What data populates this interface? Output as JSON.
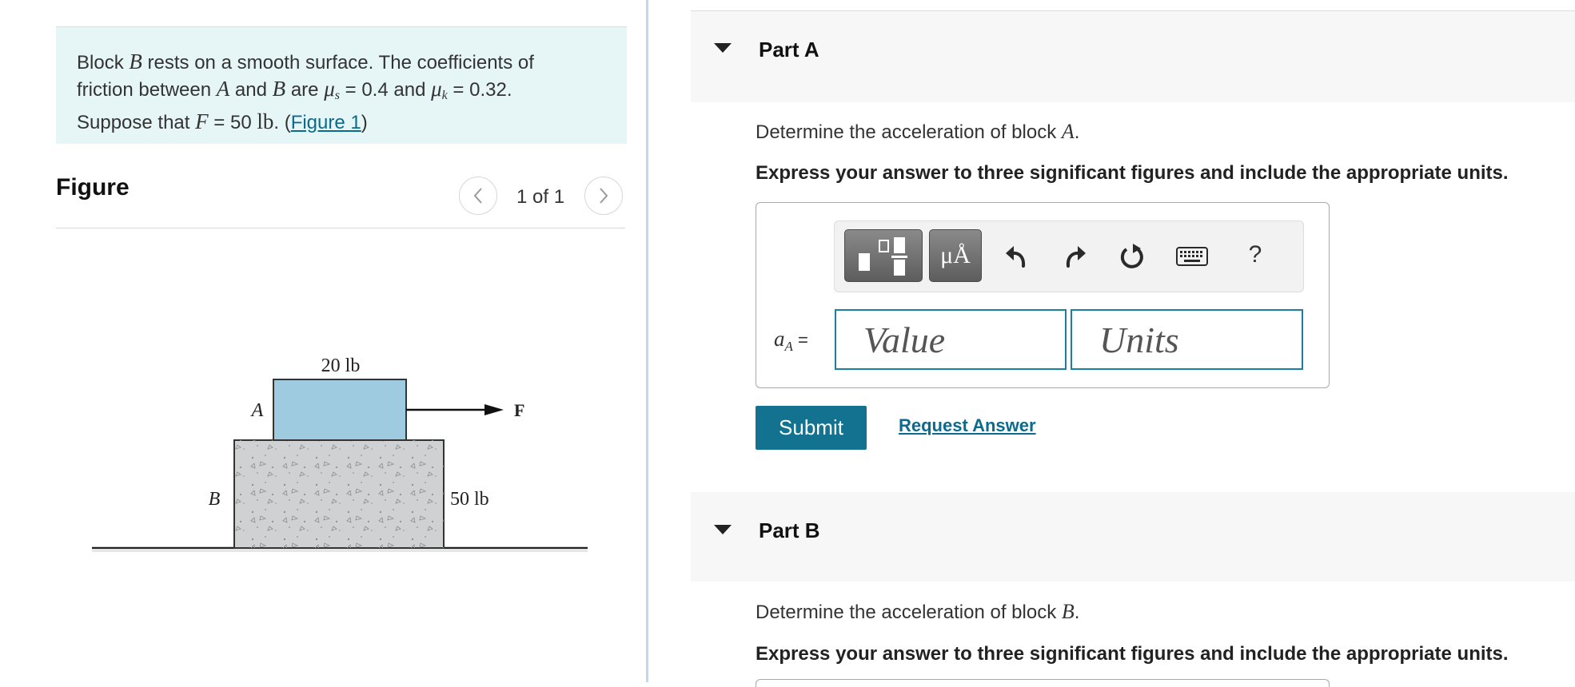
{
  "problem": {
    "line1_pre": "Block ",
    "var_B": "B",
    "line1_post": " rests on a smooth surface. The coefficients of",
    "line2_pre": "friction between ",
    "var_A": "A",
    "line2_and": " and ",
    "line2_are": " are ",
    "mu": "μ",
    "sub_s": "s",
    "mu_s_value": " = 0.4 and ",
    "sub_k": "k",
    "mu_k_value": " = 0.32.",
    "line3_pre": "Suppose that ",
    "var_F": "F",
    "line3_eq": " = 50 ",
    "unit_lb": "lb",
    "line3_paren_open": ". (",
    "figure_link": "Figure 1",
    "line3_paren_close": ")"
  },
  "figure": {
    "header": "Figure",
    "count": "1 of 1",
    "prev_icon": "chevron-left-icon",
    "next_icon": "chevron-right-icon",
    "labels": {
      "weight_a": "20 lb",
      "weight_b": "50 lb",
      "block_a": "A",
      "block_b": "B",
      "force": "F"
    },
    "colors": {
      "block_a": "#9ecbe0",
      "block_b": "#cfd1d3"
    }
  },
  "part_a": {
    "title": "Part A",
    "question_pre": "Determine the acceleration of block ",
    "question_var": "A",
    "question_post": ".",
    "instruction": "Express your answer to three significant figures and include the appropriate units.",
    "answer_label_var": "a",
    "answer_label_sub": "A",
    "answer_label_eq": " =",
    "value_placeholder": "Value",
    "units_placeholder": "Units",
    "symbols_label": "μÅ",
    "help_label": "?",
    "submit": "Submit",
    "request_answer": "Request Answer"
  },
  "part_b": {
    "title": "Part B",
    "question_pre": "Determine the acceleration of block ",
    "question_var": "B",
    "question_post": ".",
    "instruction": "Express your answer to three significant figures and include the appropriate units."
  },
  "colors": {
    "accent": "#12728f",
    "link": "#0a6b8e",
    "input_border": "#1a7fa0",
    "problem_bg": "#e6f5f5"
  }
}
